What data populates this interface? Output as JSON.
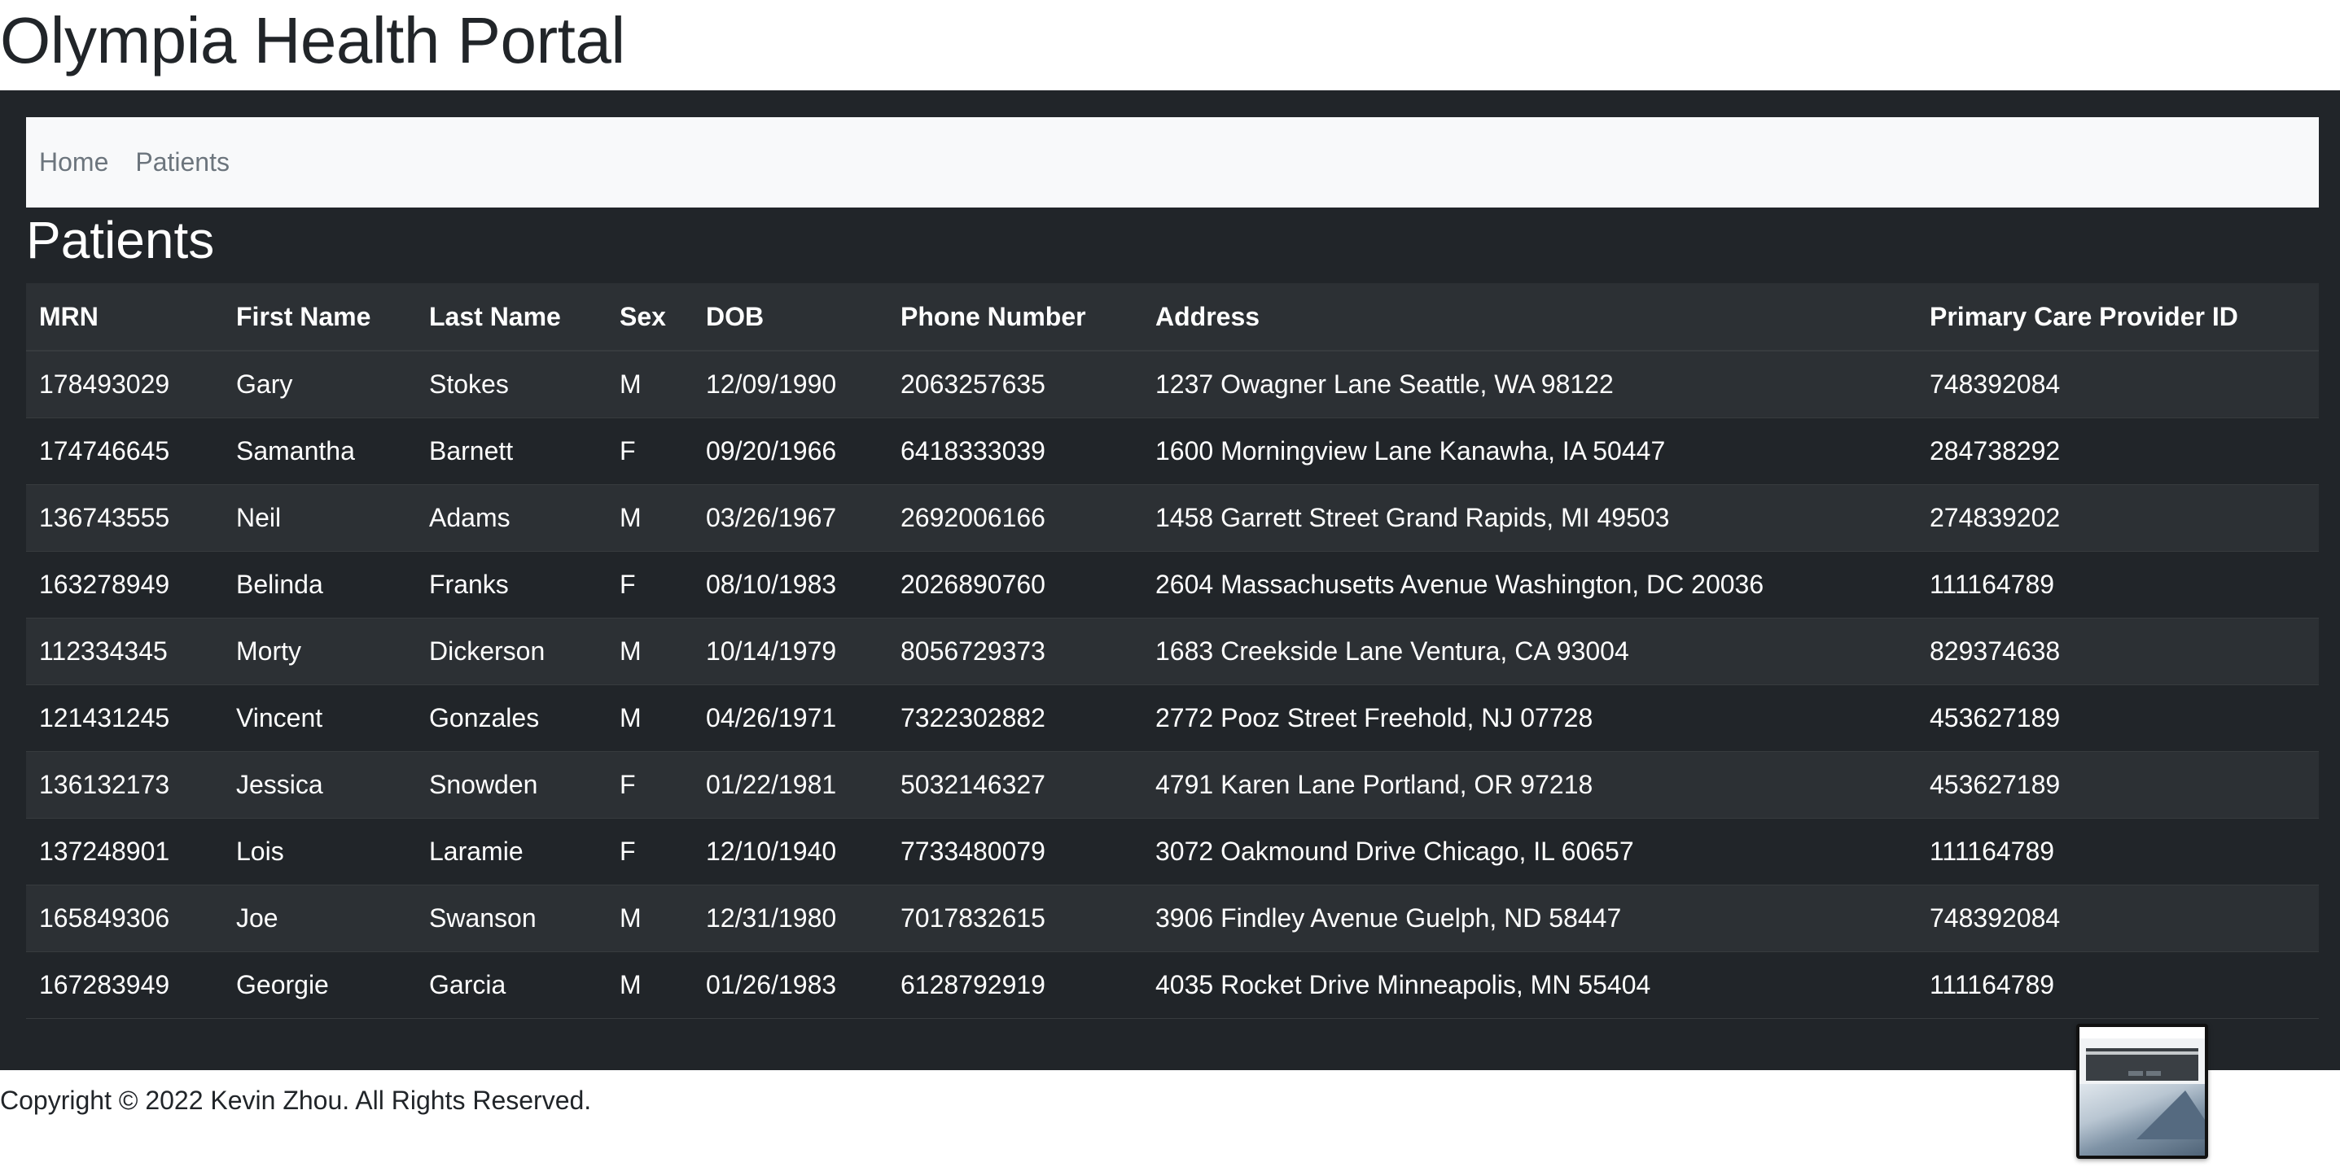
{
  "site": {
    "title": "Olympia Health Portal"
  },
  "nav": {
    "items": [
      {
        "label": "Home"
      },
      {
        "label": "Patients"
      }
    ]
  },
  "page": {
    "heading": "Patients"
  },
  "table": {
    "headers": [
      "MRN",
      "First Name",
      "Last Name",
      "Sex",
      "DOB",
      "Phone Number",
      "Address",
      "Primary Care Provider ID"
    ],
    "rows": [
      [
        "178493029",
        "Gary",
        "Stokes",
        "M",
        "12/09/1990",
        "2063257635",
        "1237 Owagner Lane Seattle, WA 98122",
        "748392084"
      ],
      [
        "174746645",
        "Samantha",
        "Barnett",
        "F",
        "09/20/1966",
        "6418333039",
        "1600 Morningview Lane Kanawha, IA 50447",
        "284738292"
      ],
      [
        "136743555",
        "Neil",
        "Adams",
        "M",
        "03/26/1967",
        "2692006166",
        "1458 Garrett Street Grand Rapids, MI 49503",
        "274839202"
      ],
      [
        "163278949",
        "Belinda",
        "Franks",
        "F",
        "08/10/1983",
        "2026890760",
        "2604 Massachusetts Avenue Washington, DC 20036",
        "111164789"
      ],
      [
        "112334345",
        "Morty",
        "Dickerson",
        "M",
        "10/14/1979",
        "8056729373",
        "1683 Creekside Lane Ventura, CA 93004",
        "829374638"
      ],
      [
        "121431245",
        "Vincent",
        "Gonzales",
        "M",
        "04/26/1971",
        "7322302882",
        "2772 Pooz Street Freehold, NJ 07728",
        "453627189"
      ],
      [
        "136132173",
        "Jessica",
        "Snowden",
        "F",
        "01/22/1981",
        "5032146327",
        "4791 Karen Lane Portland, OR 97218",
        "453627189"
      ],
      [
        "137248901",
        "Lois",
        "Laramie",
        "F",
        "12/10/1940",
        "7733480079",
        "3072 Oakmound Drive Chicago, IL 60657",
        "111164789"
      ],
      [
        "165849306",
        "Joe",
        "Swanson",
        "M",
        "12/31/1980",
        "7017832615",
        "3906 Findley Avenue Guelph, ND 58447",
        "748392084"
      ],
      [
        "167283949",
        "Georgie",
        "Garcia",
        "M",
        "01/26/1983",
        "6128792919",
        "4035 Rocket Drive Minneapolis, MN 55404",
        "111164789"
      ]
    ]
  },
  "footer": {
    "text": "Copyright © 2022 Kevin Zhou. All Rights Reserved."
  },
  "colors": {
    "dark_bg": "#212529",
    "striped_row": "#2c3034",
    "nav_bg": "#f8f9fa",
    "nav_link": "#6c757d"
  }
}
